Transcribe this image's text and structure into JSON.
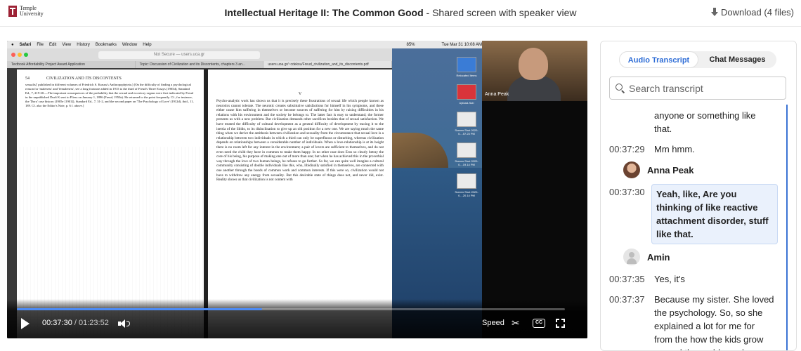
{
  "header": {
    "logo_text_line1": "Temple",
    "logo_text_line2": "University",
    "title_bold": "Intellectual Heritage II: The Common Good",
    "title_suffix": " - Shared screen with speaker view",
    "download_label": "Download (4 files)"
  },
  "mac": {
    "menubar_items": [
      "Safari",
      "File",
      "Edit",
      "View",
      "History",
      "Bookmarks",
      "Window",
      "Help"
    ],
    "clock": "Tue Mar 31  10:08 AM",
    "battery": "85%",
    "url": "Not Secure — users.uca.gr",
    "tabs": [
      "Textbook Affordability Project Award Application",
      "Topic: Discussion of Civilization and its Discontents, chapters 3 an...",
      "users.uoa.gr/~cdeksu/Freud_civilization_and_its_discontents.pdf"
    ],
    "desktop_labels": [
      "Relocated Items",
      "Upload-Sub",
      "Screen Shot 2020-0....57.23 PM",
      "Screen Shot 2020-0....19.14 PM",
      "Screen Shot 2020-0....20.14 PM"
    ]
  },
  "pdf": {
    "left_page_number": "54",
    "left_page_header": "CIVILIZATION AND ITS DISCONTENTS",
    "left_page_text": "sexualis]' published in different volumes of Friedrich S. Krauss's Anthropophyteia.) [On the difficulty of finding a psychological reason for 'maleness' and 'femaleness', see a long footnote added in 1915 to the third of Freud's Three Essays (1905d), Standard Ed., 7, 219-20.—The important consequences of the probability that the sexual and excretory organs were first indicated by Freud in the unpublished Draft K sent to Fliess on January 1, 1896 (Freud, 1950a). He returned to the point frequently. Cf., for instance, the 'Dora' case history (1905e [1901]), Standard Ed., 7, 31-2, and the second paper on 'The Psychology of Love' (1912d), ibid., 11, 189. Cf. also the Editor's Note, p. 6 f. above.]",
    "right_page_number": "V",
    "right_page_text": "Psycho-analytic work has shown us that it is precisely these frustrations of sexual life which people known as neurotics cannot tolerate. The neurotic creates substitutive satisfactions for himself in his symptoms, and these either cause him suffering in themselves or become sources of suffering for him by raising difficulties in his relations with his environment and the society he belongs to. The latter fact is easy to understand; the former presents us with a new problem. But civilization demands other sacrifices besides that of sexual satisfaction. We have treated the difficulty of cultural development as a general difficulty of development by tracing it to the inertia of the libido, to its disinclination to give up an old position for a new one. We are saying much the same thing when we derive the antithesis between civilization and sexuality from the circumstance that sexual love is a relationship between two individuals in which a third can only be superfluous or disturbing, whereas civilization depends on relationships between a considerable number of individuals. When a love-relationship is at its height there is no room left for any interest in the environment; a pair of lovers are sufficient to themselves, and do not even need the child they have in common to make them happy. In no other case does Eros so clearly betray the core of his being, his purpose of making one out of more than one; but when he has achieved this in the proverbial way through the love of two human beings, he refuses to go further. So far, we can quite well imagine a cultural community consisting of double individuals like this, who, libidinally satisfied in themselves, are connected with one another through the bonds of common work and common interests. If this were so, civilization would not have to withdraw any energy from sexuality. But this desirable state of things does not, and never did, exist. Reality shows us that civilization is not content with"
  },
  "speaker_video": {
    "name": "Anna Peak"
  },
  "player": {
    "current_time": "00:37:30",
    "separator": " / ",
    "duration": "01:23:52",
    "progress_fraction": 0.447,
    "speed_label": "Speed",
    "cc_label": "CC"
  },
  "transcript": {
    "tabs": [
      "Audio Transcript",
      "Chat Messages"
    ],
    "search_placeholder": "Search transcript",
    "accent_color": "#2d6cd6",
    "entries": [
      {
        "time": "",
        "text": "anyone or something like that."
      },
      {
        "time": "00:37:29",
        "text": "Mm hmm."
      },
      {
        "speaker": "Anna Peak"
      },
      {
        "time": "00:37:30",
        "text": "Yeah, like, Are you thinking of like reactive attachment disorder, stuff like that."
      },
      {
        "speaker": "Amin"
      },
      {
        "time": "00:37:35",
        "text": "Yes, it's"
      },
      {
        "time": "00:37:37",
        "text": "Because my sister. She loved the psychology. So, so she explained a lot for me for from the how the kids grow up and the problem when"
      }
    ]
  }
}
